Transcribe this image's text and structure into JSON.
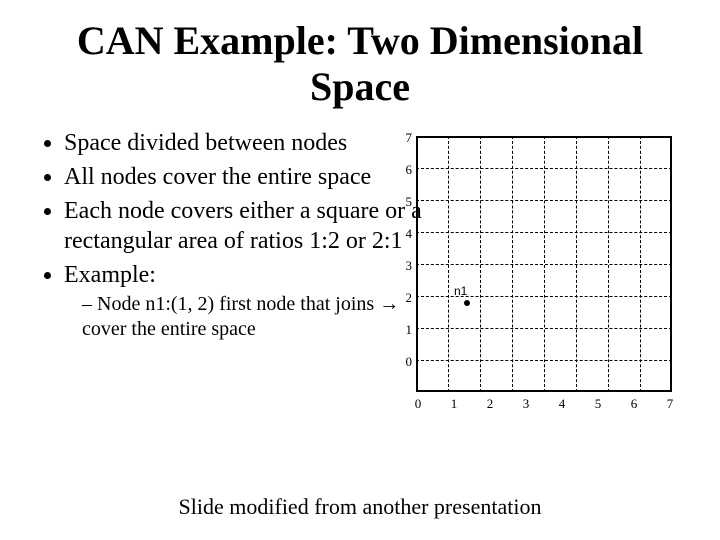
{
  "title": "CAN Example: Two Dimensional Space",
  "bullets": {
    "b1": "Space divided between nodes",
    "b2": "All nodes cover the entire space",
    "b3": "Each node covers either a square or a rectangular area of ratios 1:2 or 2:1",
    "b4": "Example:",
    "sub1_a": "Node n1:(1, 2) first node that joins ",
    "sub1_b": " cover the entire space"
  },
  "arrow": "→",
  "footer": "Slide modified from another presentation",
  "chart_data": {
    "type": "scatter",
    "title": "",
    "xlabel": "",
    "ylabel": "",
    "xlim": [
      0,
      7
    ],
    "ylim": [
      0,
      7
    ],
    "x_ticks": [
      "0",
      "1",
      "2",
      "3",
      "4",
      "5",
      "6",
      "7"
    ],
    "y_ticks": [
      "0",
      "1",
      "2",
      "3",
      "4",
      "5",
      "6",
      "7"
    ],
    "series": [
      {
        "name": "n1",
        "points": [
          [
            1.5,
            2.2
          ]
        ]
      }
    ],
    "node_label": "n1"
  }
}
